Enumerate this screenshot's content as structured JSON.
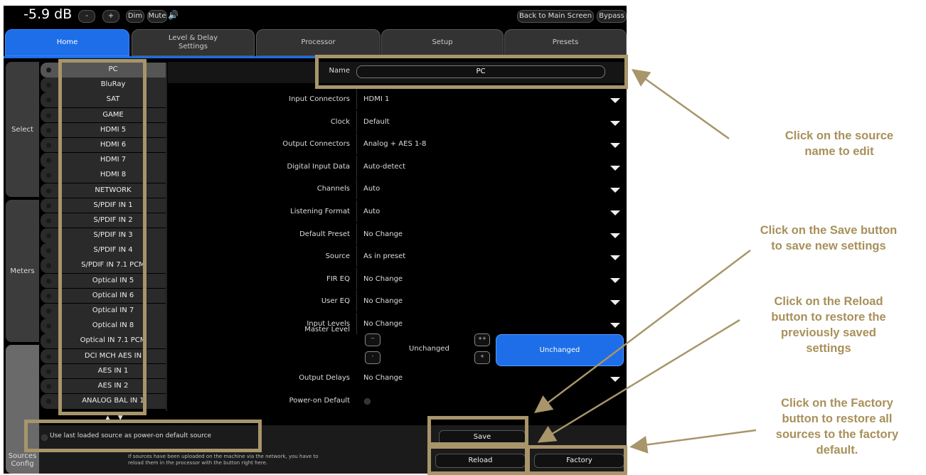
{
  "topbar": {
    "volume": "-5.9 dB",
    "minus_label": "-",
    "plus_label": "+",
    "dim_label": "Dim",
    "mute_label": "Mute",
    "speaker_icon": "🔊",
    "back_label": "Back to Main Screen",
    "bypass_label": "Bypass"
  },
  "tabs": [
    {
      "label": "Home"
    },
    {
      "label": "Level & Delay\nSettings"
    },
    {
      "label": "Processor"
    },
    {
      "label": "Setup"
    },
    {
      "label": "Presets"
    }
  ],
  "leftnav": [
    {
      "label": "Select"
    },
    {
      "label": "Meters"
    },
    {
      "label": "Sources\nConfig"
    }
  ],
  "sources": [
    "PC",
    "BluRay",
    "SAT",
    "GAME",
    "HDMI 5",
    "HDMI 6",
    "HDMI 7",
    "HDMI 8",
    "NETWORK",
    "S/PDIF IN 1",
    "S/PDIF IN 2",
    "S/PDIF IN 3",
    "S/PDIF IN 4",
    "S/PDIF IN 7.1 PCM",
    "Optical IN 5",
    "Optical IN 6",
    "Optical IN 7",
    "Optical IN 8",
    "Optical IN 7.1 PCM",
    "DCI MCH AES IN",
    "AES IN 1",
    "AES IN 2",
    "ANALOG BAL IN 1"
  ],
  "scroll_arrows": "▲ ▼",
  "name": {
    "label": "Name",
    "value": "PC"
  },
  "settings": [
    {
      "label": "Input Connectors",
      "value": "HDMI 1"
    },
    {
      "label": "Clock",
      "value": "Default"
    },
    {
      "label": "Output Connectors",
      "value": "Analog + AES 1-8"
    },
    {
      "label": "Digital Input Data",
      "value": "Auto-detect"
    },
    {
      "label": "Channels",
      "value": "Auto"
    },
    {
      "label": "Listening Format",
      "value": "Auto"
    },
    {
      "label": "Default Preset",
      "value": "No Change"
    },
    {
      "label": "Source",
      "value": "As in preset"
    },
    {
      "label": "FIR EQ",
      "value": "No Change"
    },
    {
      "label": "User EQ",
      "value": "No Change"
    },
    {
      "label": "Input Levels",
      "value": "No Change"
    }
  ],
  "master_level": {
    "label": "Master Level",
    "value": "Unchanged",
    "button": "Unchanged",
    "btn_mm": "--",
    "btn_m": "-",
    "btn_pp": "++",
    "btn_p": "+"
  },
  "output_delays": {
    "label": "Output Delays",
    "value": "No Change"
  },
  "power_on_default": {
    "label": "Power-on Default"
  },
  "power_option": "Use last loaded source as power-on default source",
  "buttons": {
    "save": "Save",
    "reload": "Reload",
    "factory": "Factory"
  },
  "note": "If sources have been uploaded on the machine via the network, you have to\nreload them in the processor with the button right here.",
  "annotations": {
    "edit_name": "Click on the source\nname to edit",
    "save": "Click on the Save button\nto save new settings",
    "reload": "Click on the Reload\nbutton to restore the\npreviously saved\nsettings",
    "factory": "Click on the Factory\nbutton to restore all\nsources to the factory\ndefault."
  },
  "colors": {
    "accent": "#1d6ee8",
    "highlight": "#a8956a",
    "annotation_text": "#a8905a"
  }
}
